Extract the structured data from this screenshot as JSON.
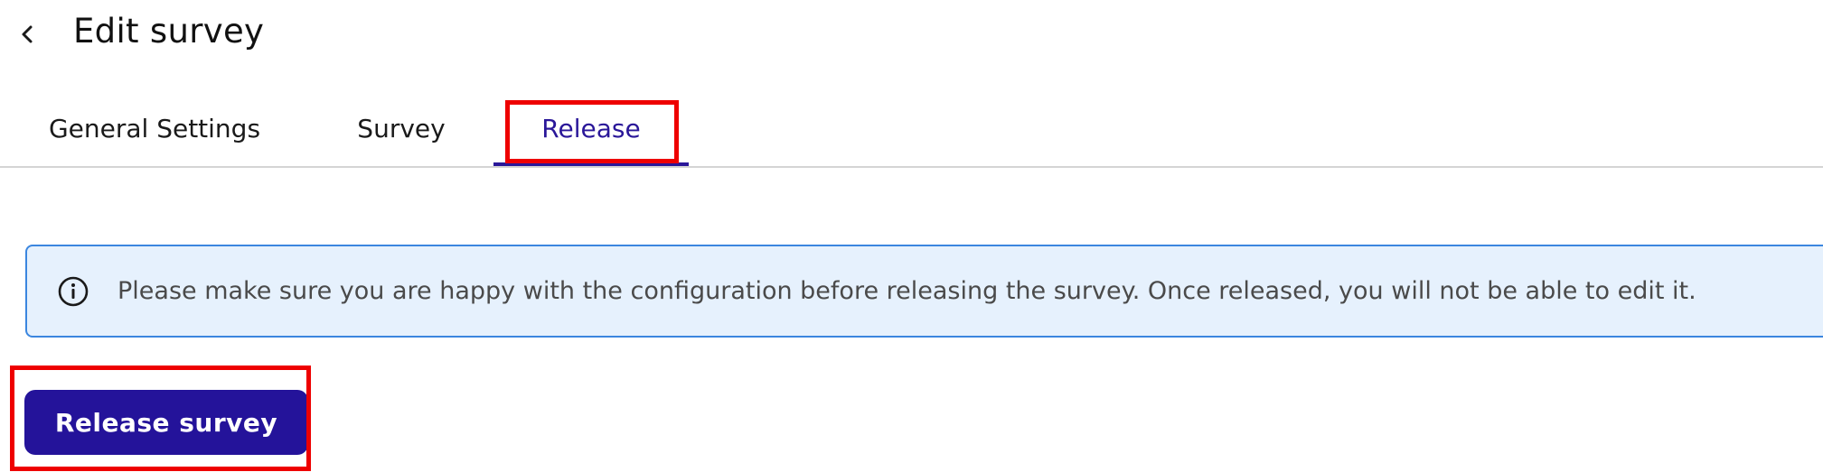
{
  "header": {
    "back_icon": "chevron-left-icon",
    "title": "Edit survey"
  },
  "tabs": [
    {
      "label": "General Settings",
      "active": false
    },
    {
      "label": "Survey",
      "active": false
    },
    {
      "label": "Release",
      "active": true
    }
  ],
  "banner": {
    "icon": "info-icon",
    "text": "Please make sure you are happy with the configuration before releasing the survey. Once released, you will not be able to edit it."
  },
  "actions": {
    "release_label": "Release survey"
  },
  "colors": {
    "accent": "#2a1799",
    "button_bg": "#24139a",
    "banner_bg": "#e6f1fd",
    "banner_border": "#3b86df",
    "highlight": "#ee0000"
  }
}
